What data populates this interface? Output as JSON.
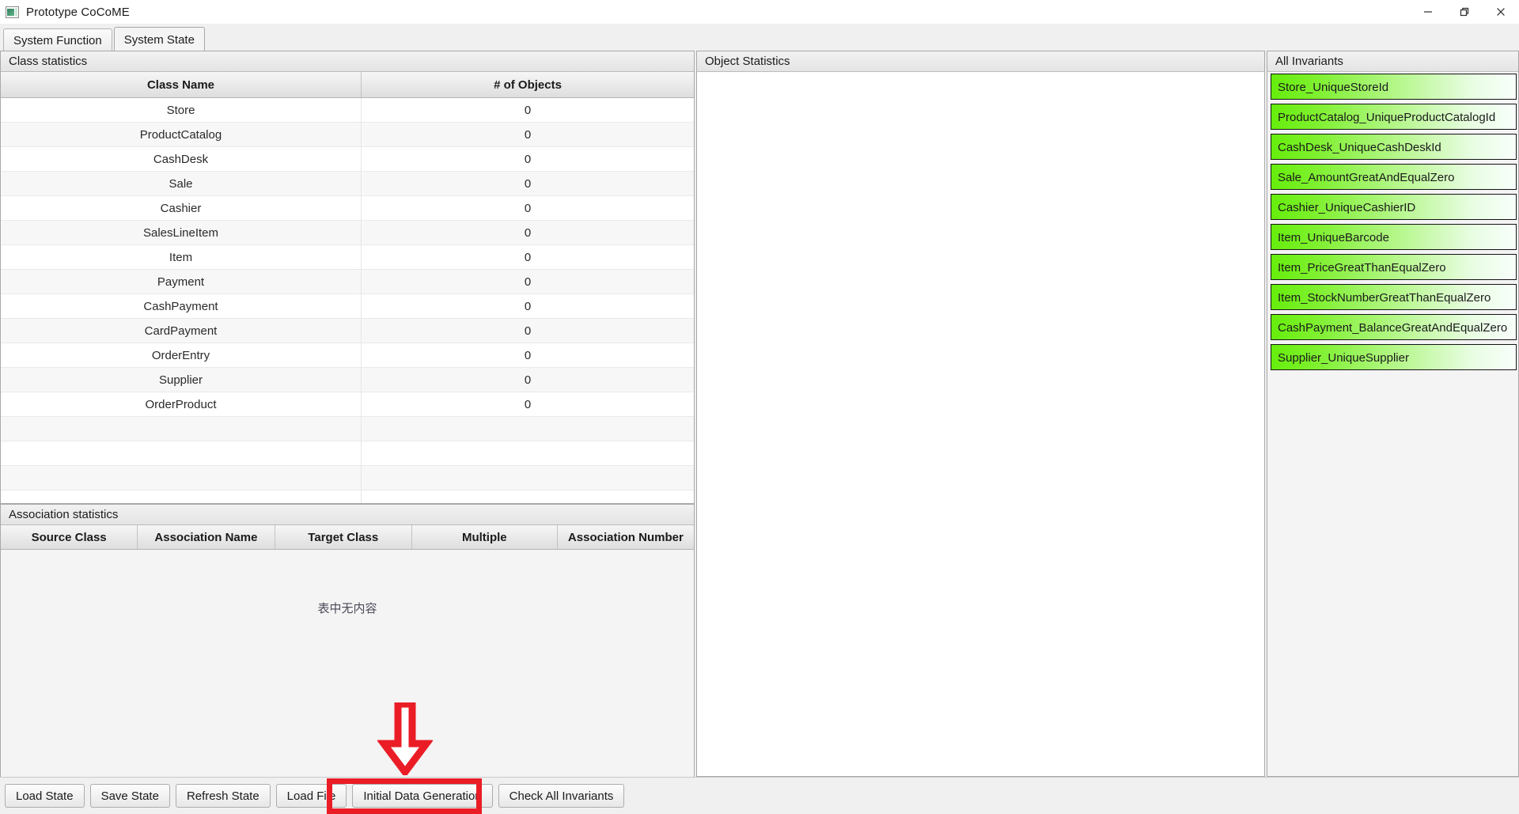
{
  "window": {
    "title": "Prototype CoCoME",
    "icon": "app-window-icon",
    "controls": {
      "minimize": "minimize-icon",
      "maximize": "maximize-icon",
      "close": "close-icon"
    }
  },
  "tabs": [
    {
      "label": "System Function",
      "active": false
    },
    {
      "label": "System State",
      "active": true
    }
  ],
  "class_statistics": {
    "panel_title": "Class statistics",
    "columns": [
      "Class Name",
      "# of Objects"
    ],
    "rows": [
      {
        "name": "Store",
        "count": "0"
      },
      {
        "name": "ProductCatalog",
        "count": "0"
      },
      {
        "name": "CashDesk",
        "count": "0"
      },
      {
        "name": "Sale",
        "count": "0"
      },
      {
        "name": "Cashier",
        "count": "0"
      },
      {
        "name": "SalesLineItem",
        "count": "0"
      },
      {
        "name": "Item",
        "count": "0"
      },
      {
        "name": "Payment",
        "count": "0"
      },
      {
        "name": "CashPayment",
        "count": "0"
      },
      {
        "name": "CardPayment",
        "count": "0"
      },
      {
        "name": "OrderEntry",
        "count": "0"
      },
      {
        "name": "Supplier",
        "count": "0"
      },
      {
        "name": "OrderProduct",
        "count": "0"
      },
      {
        "name": "",
        "count": ""
      },
      {
        "name": "",
        "count": ""
      },
      {
        "name": "",
        "count": ""
      },
      {
        "name": "",
        "count": ""
      }
    ]
  },
  "association_statistics": {
    "panel_title": "Association statistics",
    "columns": [
      "Source Class",
      "Association Name",
      "Target Class",
      "Multiple",
      "Association Number"
    ],
    "rows": [],
    "empty_message": "表中无内容"
  },
  "object_statistics": {
    "panel_title": "Object Statistics",
    "rows": []
  },
  "invariants": {
    "panel_title": "All Invariants",
    "items": [
      "Store_UniqueStoreId",
      "ProductCatalog_UniqueProductCatalogId",
      "CashDesk_UniqueCashDeskId",
      "Sale_AmountGreatAndEqualZero",
      "Cashier_UniqueCashierID",
      "Item_UniqueBarcode",
      "Item_PriceGreatThanEqualZero",
      "Item_StockNumberGreatThanEqualZero",
      "CashPayment_BalanceGreatAndEqualZero",
      "Supplier_UniqueSupplier"
    ],
    "item_color_start": "#66ee0c",
    "item_color_end": "#f8fffb"
  },
  "buttons": [
    "Load State",
    "Save State",
    "Refresh State",
    "Load File",
    "Initial Data Generation",
    "Check All Invariants"
  ],
  "annotation": {
    "highlight_target": "Initial Data Generation",
    "color": "#ea1d26",
    "arrow": "down-arrow-annotation"
  }
}
